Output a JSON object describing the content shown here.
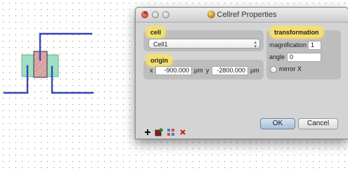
{
  "dialog": {
    "title": "Cellref Properties",
    "cell_group": {
      "label": "cell",
      "selected_cell": "Cell1"
    },
    "origin_group": {
      "label": "origin",
      "x_label": "x",
      "x_value": "-900.000",
      "x_unit": "µm",
      "y_label": "y",
      "y_value": "-2800.000",
      "y_unit": "µm"
    },
    "transformation_group": {
      "label": "transformation",
      "magnification_label": "magnification",
      "magnification_value": "1",
      "angle_label": "angle",
      "angle_value": "0",
      "mirror_label": "mirror X",
      "mirror_checked": false
    },
    "toolbar": {
      "add_icon": "plus-icon",
      "paint_icon": "fill-icon",
      "array_icon": "array-icon",
      "delete_icon": "x-icon"
    },
    "buttons": {
      "ok": "OK",
      "cancel": "Cancel"
    }
  },
  "canvas": {
    "wire_color": "#3747b5",
    "box_green": "#7fd6b0",
    "box_pink": "#d9a3a3"
  }
}
